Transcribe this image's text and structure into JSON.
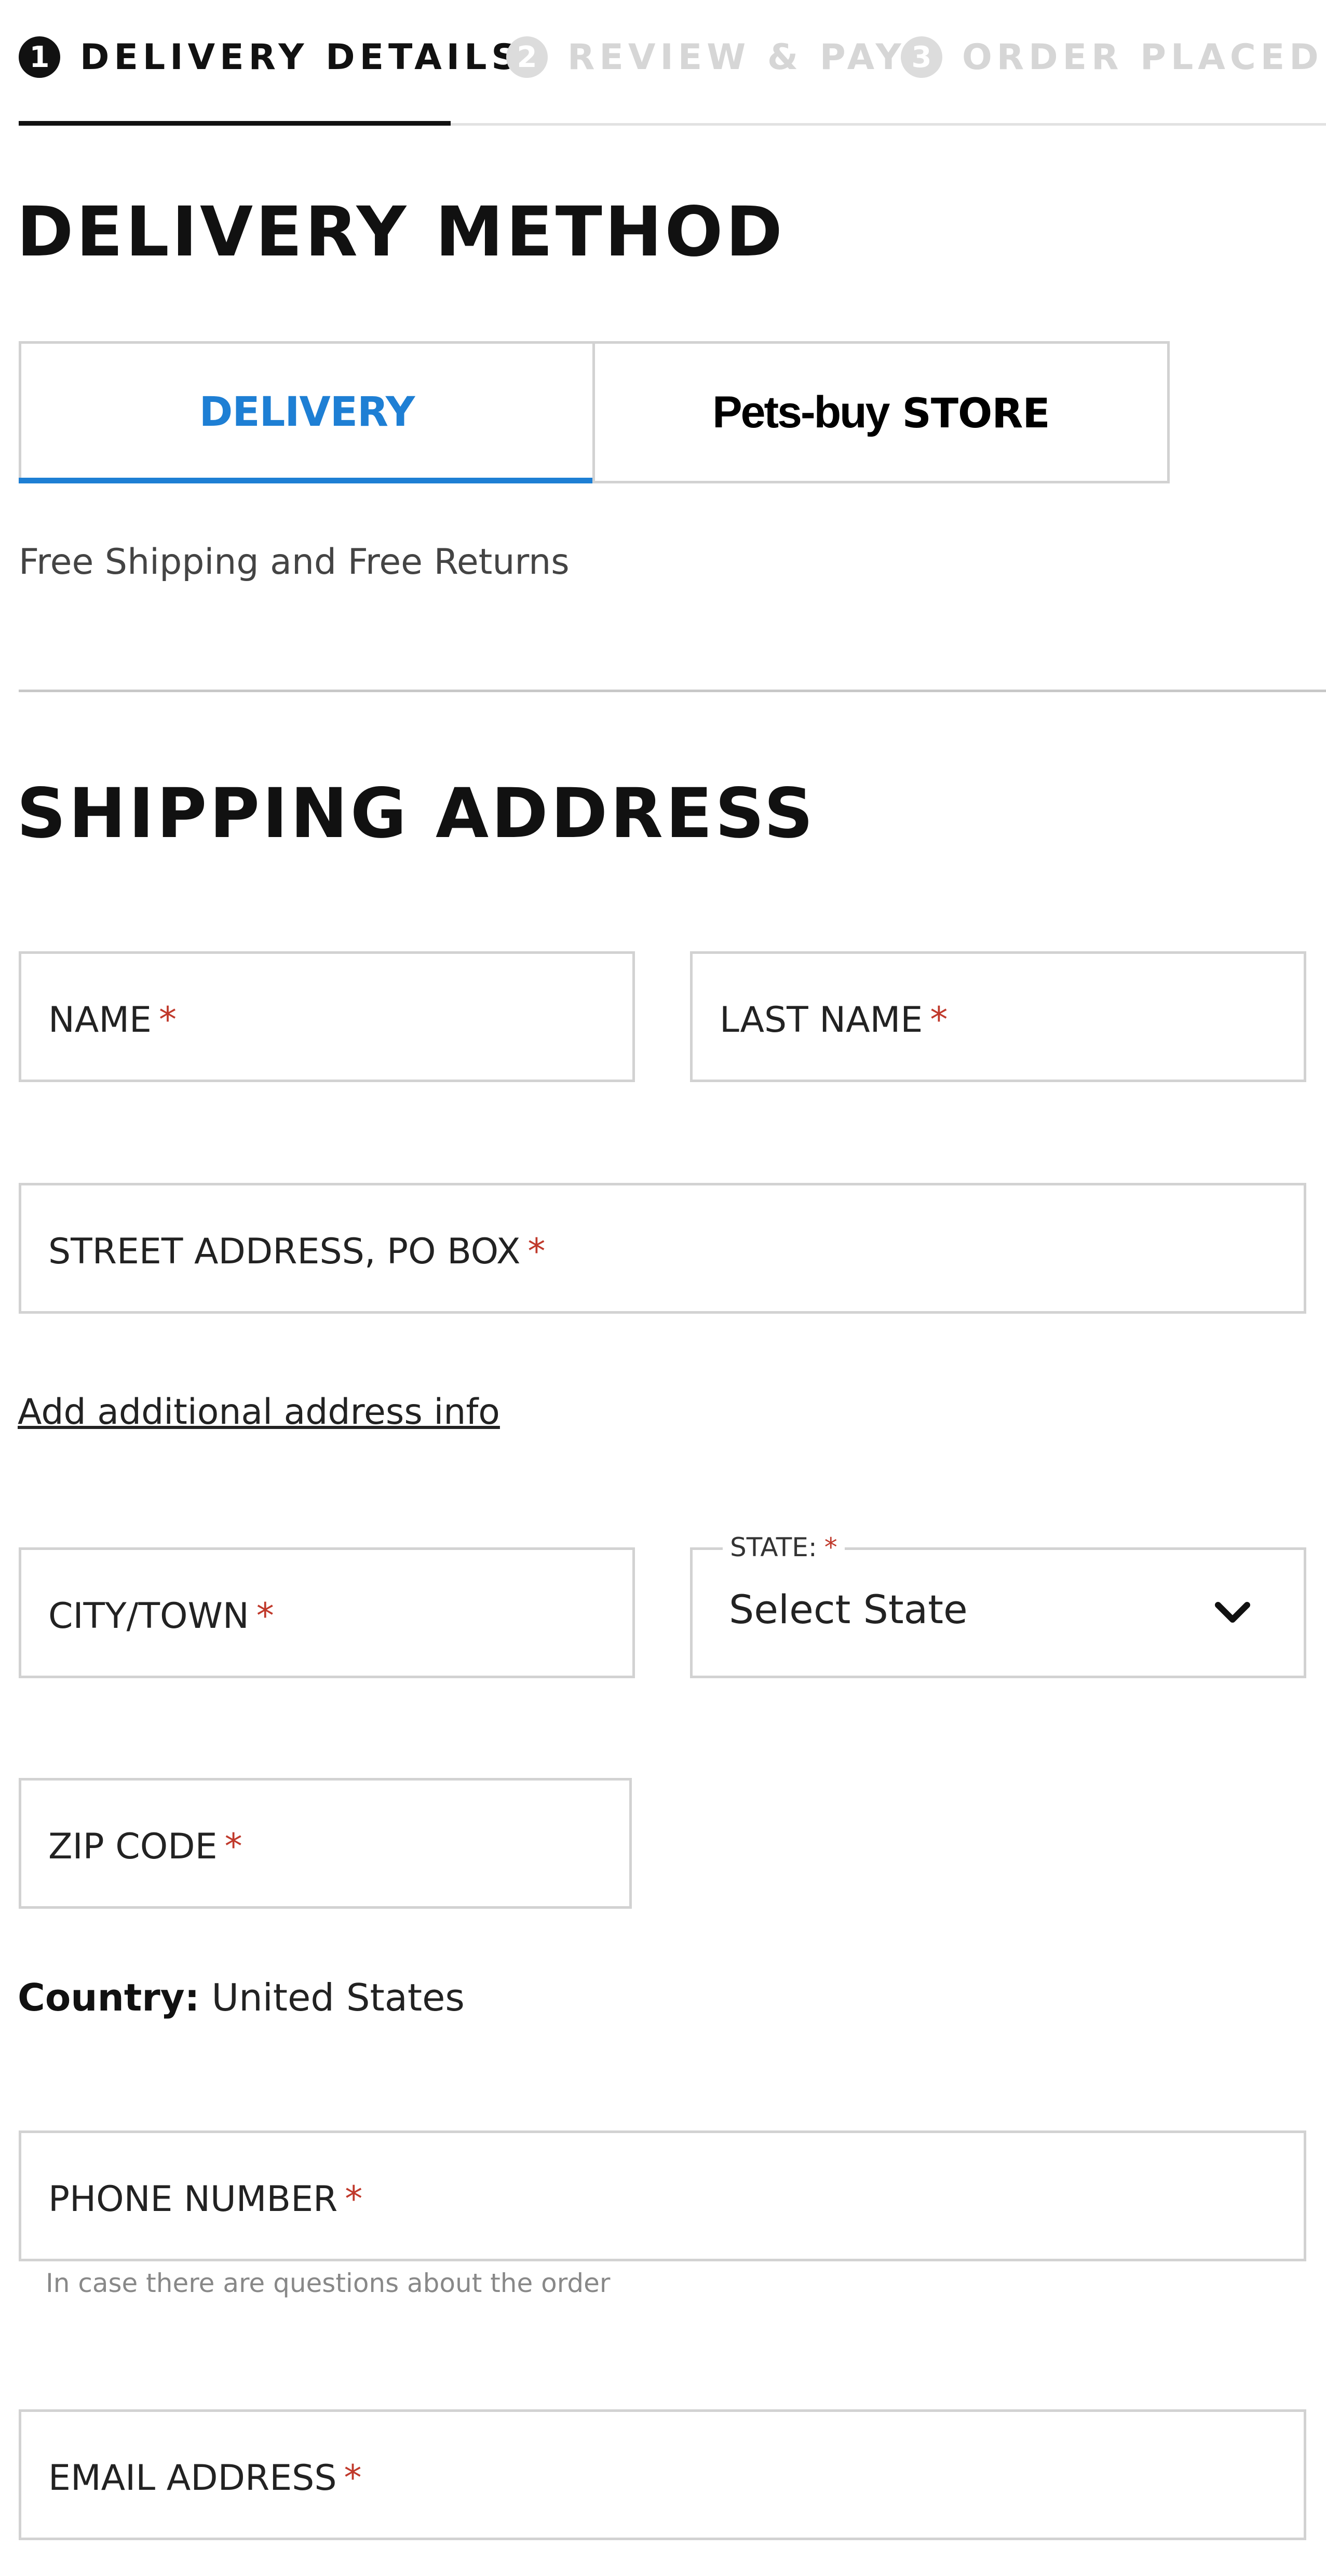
{
  "steps": [
    {
      "number": "1",
      "label": "DELIVERY DETAILS",
      "active": true
    },
    {
      "number": "2",
      "label": "REVIEW & PAY",
      "active": false
    },
    {
      "number": "3",
      "label": "ORDER PLACED",
      "active": false
    }
  ],
  "delivery_method": {
    "title": "DELIVERY METHOD",
    "tabs": [
      {
        "label": "DELIVERY",
        "selected": true
      },
      {
        "label_part1": "Pets-buy",
        "label_part2": "STORE",
        "selected": false
      }
    ],
    "note": "Free Shipping and Free Returns"
  },
  "shipping": {
    "title": "SHIPPING ADDRESS",
    "fields": {
      "name": "NAME",
      "last_name": "LAST NAME",
      "street": "STREET ADDRESS, PO BOX",
      "city": "CITY/TOWN",
      "state_label": "STATE:",
      "state_value": "Select State",
      "zip": "ZIP CODE",
      "phone": "PHONE NUMBER",
      "email": "EMAIL ADDRESS"
    },
    "required_mark": "*",
    "add_info_link": "Add additional address info",
    "country_label": "Country:",
    "country_value": "United States",
    "phone_hint": "In case there are questions about the order"
  },
  "colors": {
    "accent": "#1e7fd4",
    "required": "#c0392b",
    "border": "#d2d2d2",
    "inactive_step": "#d6d6d6"
  },
  "icons": {
    "state_dropdown": "chevron-down-icon"
  }
}
